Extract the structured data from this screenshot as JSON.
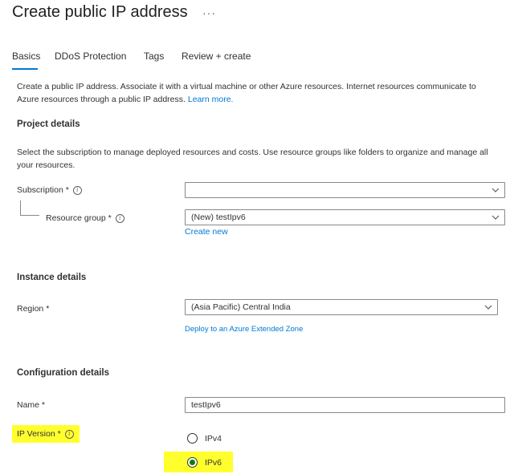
{
  "header": {
    "title": "Create public IP address",
    "more_label": "···"
  },
  "tabs": [
    {
      "label": "Basics",
      "active": true
    },
    {
      "label": "DDoS Protection",
      "active": false
    },
    {
      "label": "Tags",
      "active": false
    },
    {
      "label": "Review + create",
      "active": false
    }
  ],
  "intro": {
    "text": "Create a public IP address. Associate it with a virtual machine or other Azure resources. Internet resources communicate to Azure resources through a public IP address.",
    "learn_more": "Learn more."
  },
  "project": {
    "heading": "Project details",
    "description": "Select the subscription to manage deployed resources and costs. Use resource groups like folders to organize and manage all your resources.",
    "subscription_label": "Subscription *",
    "subscription_value": "",
    "resource_group_label": "Resource group *",
    "resource_group_value": "(New) testIpv6",
    "create_new": "Create new"
  },
  "instance": {
    "heading": "Instance details",
    "region_label": "Region *",
    "region_value": "(Asia Pacific) Central India",
    "extended_zone_link": "Deploy to an Azure Extended Zone"
  },
  "configuration": {
    "heading": "Configuration details",
    "name_label": "Name *",
    "name_value": "testIpv6",
    "ip_version_label": "IP Version *",
    "ip_version_options": [
      {
        "label": "IPv4",
        "selected": false
      },
      {
        "label": "IPv6",
        "selected": true
      }
    ]
  },
  "colors": {
    "accent": "#0078d4",
    "highlight": "#ffff2e",
    "radio_selected": "#107c10"
  },
  "icons": {
    "info": "info-icon",
    "chevron": "chevron-down-icon",
    "more": "ellipsis-icon"
  }
}
